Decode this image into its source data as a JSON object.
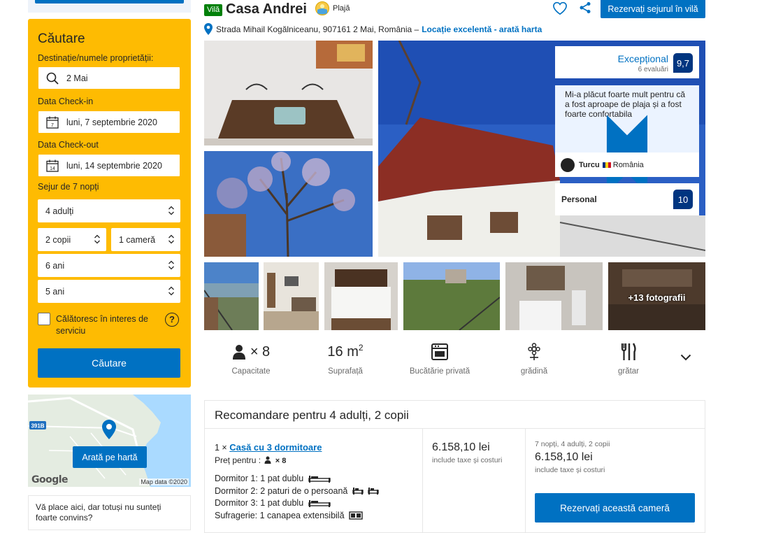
{
  "sidebar": {
    "search": {
      "title": "Căutare",
      "destination_label": "Destinație/numele proprietății:",
      "destination_value": "2 Mai",
      "checkin_label": "Data Check-in",
      "checkin_value": "luni, 7 septembrie 2020",
      "checkin_day": "7",
      "checkout_label": "Data Check-out",
      "checkout_value": "luni, 14 septembrie 2020",
      "checkout_day": "14",
      "stay_label": "Sejur de 7 nopți",
      "adults": "4 adulți",
      "children": "2 copii",
      "rooms": "1 cameră",
      "child_age_1": "6 ani",
      "child_age_2": "5 ani",
      "business_label": "Călătoresc în interes de serviciu",
      "help_icon": "?",
      "button": "Căutare"
    },
    "map": {
      "button": "Arată pe hartă",
      "road_label": "391B",
      "google": "Google",
      "data": "Map data ©2020"
    },
    "feedback": "Vă place aici, dar totuși nu sunteți foarte convins?"
  },
  "header": {
    "type_badge": "Vilă",
    "name": "Casa Andrei",
    "beach_label": "Plajă",
    "address": "Strada Mihail Kogălniceanu, 907161 2 Mai, România –",
    "location_link": "Locație excelentă - arată harta",
    "reserve_button": "Rezervați sejurul în vilă"
  },
  "reviews": {
    "rating_word": "Excepțional",
    "reviews_count": "6 evaluări",
    "score": "9,7",
    "quote": "Mi-a plăcut foarte mult pentru că a fost aproape de plaja și a fost foarte confortabila",
    "reviewer": "Turcu",
    "reviewer_country": "România",
    "staff_label": "Personal",
    "staff_score": "10"
  },
  "gallery": {
    "more_photos": "+13 fotografii"
  },
  "facilities": {
    "capacity_value": "× 8",
    "capacity_label": "Capacitate",
    "area_value": "16 m",
    "area_unit_sup": "2",
    "area_label": "Suprafață",
    "kitchen_label": "Bucătărie privată",
    "garden_label": "grădină",
    "grill_label": "grătar"
  },
  "recommendation": {
    "title": "Recomandare pentru 4 adulți, 2 copii",
    "room_prefix": "1 ×",
    "room_name": "Casă cu 3 dormitoare",
    "price_for": "Preț pentru :",
    "price_for_count": "× 8",
    "bedroom_1": "Dormitor 1: 1 pat dublu",
    "bedroom_2": "Dormitor 2: 2 paturi de o persoană",
    "bedroom_3": "Dormitor 3: 1 pat dublu",
    "living": "Sufragerie: 1 canapea extensibilă",
    "price": "6.158,10 lei",
    "price_note": "include taxe și costuri",
    "summary_stay": "7 nopți, 4 adulți, 2 copii",
    "summary_price": "6.158,10 lei",
    "summary_note": "include taxe și costuri",
    "reserve_button": "Rezervați această cameră"
  },
  "colors": {
    "brand_blue": "#0071c2",
    "search_yellow": "#febb02",
    "score_navy": "#003580",
    "badge_green": "#008009"
  }
}
